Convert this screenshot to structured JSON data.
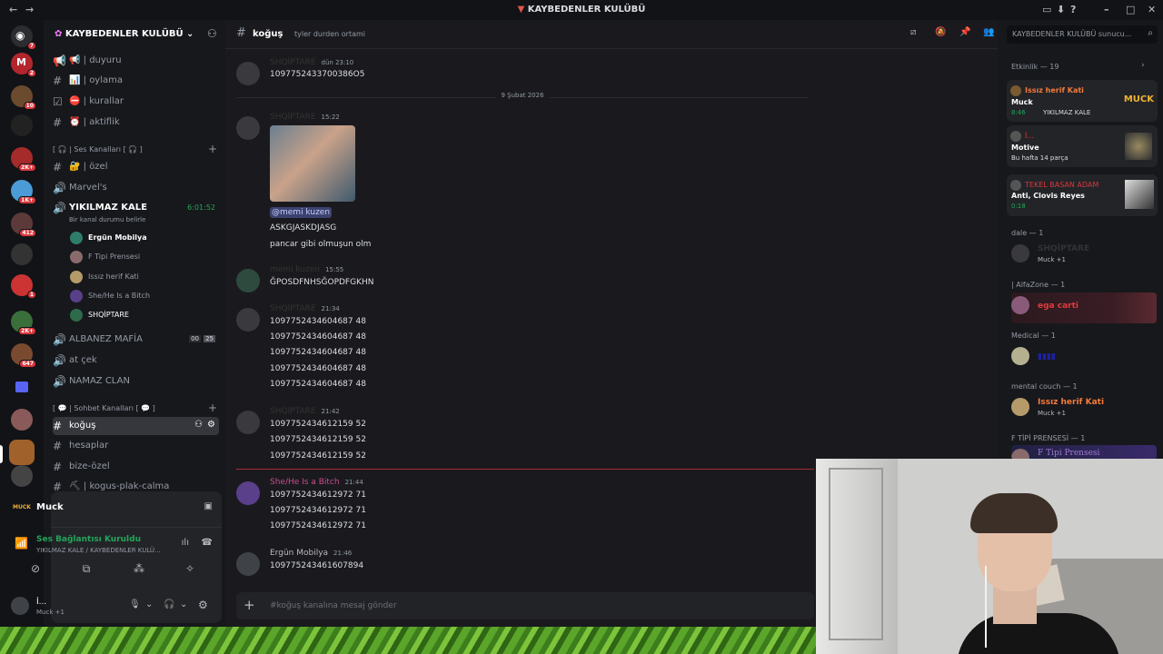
{
  "window": {
    "title": "KAYBEDENLER KULÜBÜ",
    "back": "←",
    "forward": "→"
  },
  "servers": {
    "badges": [
      "7",
      "2",
      "10",
      "2K+",
      "1K+",
      "412",
      "2K+",
      "1",
      "2K+",
      "647"
    ]
  },
  "guild": {
    "name": "KAYBEDENLER KULÜBÜ"
  },
  "channels": {
    "top": [
      {
        "icon": "📢",
        "label": "| duyuru"
      },
      {
        "icon": "📊",
        "label": "| oylama"
      },
      {
        "icon": "⛔",
        "label": "| kurallar"
      },
      {
        "icon": "⏰",
        "label": "| aktiflik"
      }
    ],
    "voice_category": "[ 🎧 | Ses Kanalları [ 🎧 ]",
    "voice": [
      {
        "label": "| özel",
        "icon": "🔐"
      },
      {
        "label": "Marvel's"
      }
    ],
    "active_voice": {
      "name": "YIKILMAZ KALE",
      "timer": "6:01:52",
      "status": "Bir kanal durumu belirle"
    },
    "voice_users": [
      "Ergün Mobilya",
      "F Tipi Prensesi",
      "Issız herif Kati",
      "She/He Is a Bitch",
      "SHQİPTARE"
    ],
    "voice_more": [
      {
        "label": "ALBANEZ MAFİA",
        "count_a": "00",
        "count_b": "25"
      },
      {
        "label": "at çek"
      },
      {
        "label": "NAMAZ CLAN"
      }
    ],
    "text_category": "[ 💬 | Sohbet Kanalları [ 💬 ]",
    "text": [
      {
        "label": "koğuş"
      },
      {
        "label": "hesaplar"
      },
      {
        "label": "bize-özel"
      },
      {
        "label": "| kogus-plak-calma",
        "icon": "⛏"
      }
    ]
  },
  "panel": {
    "activity": "Muck",
    "voice_status": "Ses Bağlantısı Kuruldu",
    "voice_location": "YIKILMAZ KALE / KAYBEDENLER KULÜ...",
    "user_name": "İ...",
    "user_sub": "Muck +1"
  },
  "chat": {
    "channel": "koğuş",
    "topic": "tyler durden ortami",
    "date_divider": "9 Şubat 2026",
    "messages": [
      {
        "author": "SHQİPTARE",
        "time": "dün 23:10",
        "lines": [
          "1097752433700386O5"
        ]
      },
      {
        "author": "SHQİPTARE",
        "time": "15:22",
        "mention": "@memi kuzen",
        "lines": [
          "ASKGJASKDJASG",
          "pancar gibi olmuşun olm"
        ]
      },
      {
        "author": "memi kuzen",
        "time": "15:55",
        "lines": [
          "ĞPOSDFNHSĞOPDFGKHN"
        ]
      },
      {
        "author": "SHQİPTARE",
        "time": "21:34",
        "lines": [
          "1097752434604687 48",
          "1097752434604687 48",
          "1097752434604687 48",
          "1097752434604687 48",
          "1097752434604687 48"
        ]
      },
      {
        "author": "SHQİPTARE",
        "time": "21:42",
        "lines": [
          "1097752434612159 52",
          "1097752434612159 52",
          "1097752434612159 52"
        ]
      },
      {
        "author": "She/He Is a Bitch",
        "time": "21:44",
        "lines": [
          "1097752434612972 71",
          "1097752434612972 71",
          "1097752434612972 71"
        ]
      },
      {
        "author": "Ergün Mobilya",
        "time": "21:46",
        "lines": [
          "109775243461607894"
        ]
      }
    ],
    "composer_placeholder": "#koğuş kanalına mesaj gönder"
  },
  "members": {
    "search_placeholder": "KAYBEDENLER KULÜBÜ sunucu...",
    "activity_header": "Etkinlik — 19",
    "activity": [
      {
        "name": "Issız herif Kati",
        "title": "Muck",
        "sub": "8:46",
        "extra": "YIKILMAZ KALE",
        "badge": "MUCK"
      },
      {
        "name": "İ...",
        "title": "Motive",
        "sub": "Bu hafta 14 parça"
      },
      {
        "name": "TEKEL BASAN ADAM",
        "title": "Anti, Clovis Reyes",
        "sub": "0:18"
      }
    ],
    "groups": [
      {
        "header": "dale — 1",
        "name": "SHQİPTARE",
        "sub": "Muck +1"
      },
      {
        "header": "| AlfaZone — 1",
        "name": "ega carti",
        "sub": ""
      },
      {
        "header": "Medical — 1",
        "name": "▮▮▮▮",
        "sub": ""
      },
      {
        "header": "mental couch — 1",
        "name": "Issız herif Kati",
        "sub": "Muck +1"
      },
      {
        "header": "F TİPİ PRENSESİ — 1",
        "name": "F Tipi Prensesi",
        "sub": ""
      }
    ]
  }
}
